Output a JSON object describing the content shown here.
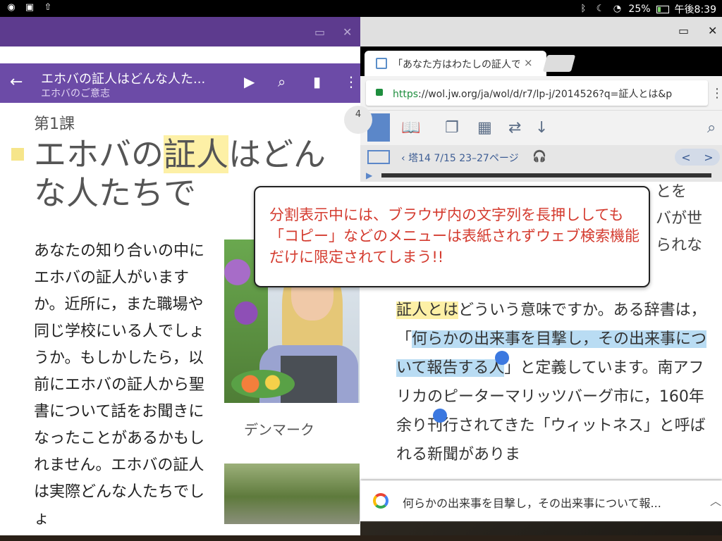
{
  "status_bar": {
    "left_icons": [
      "chrome-icon",
      "image-icon",
      "upload-icon"
    ],
    "battery": "25%",
    "time": "午後8:39"
  },
  "left_window": {
    "controls": {
      "restore": "▭",
      "close": "✕"
    },
    "app_bar": {
      "title": "エホバの証人はどんな人た...",
      "subtitle": "エホバのご意志"
    },
    "lesson_label": "第1課",
    "headline_pre": "エホバの",
    "headline_hl": "証人",
    "headline_post": "はどんな人たちで",
    "body": "あなたの知り合いの中にエホバの証人がいますか。近所に，また職場や同じ学校にいる人でしょうか。もしかしたら，以前にエホバの証人から聖書について話をお聞きになったことがあるかもしれません。エホバの証人は実際どんな人たちでしょ",
    "photo_caption": "デンマーク",
    "scroll_marker": "4"
  },
  "right_window": {
    "controls": {
      "restore": "▭",
      "close": "✕"
    },
    "tab": {
      "title": "「あなた方はわたしの証人で",
      "close": "×"
    },
    "url": {
      "scheme": "https",
      "rest": "://wol.jw.org/ja/wol/d/r7/lp-j/2014526?q=証人とは&p"
    },
    "nav": {
      "label": "塔14 7/15 23–27ページ",
      "prev": "<",
      "next": ">"
    },
    "peek_lines": [
      "とを",
      "バが世",
      "られな"
    ],
    "body": {
      "seg1_hl": "証人とは",
      "seg2": "どういう意味ですか。ある辞書は，「",
      "seg3_sel": "何らかの出来事を目撃し，その出来事について報告する人",
      "seg4": "」と定義しています。南アフリカのピーターマリッツバーグ市に，160年余り刊行されてきた「ウィットネス」と呼ばれる新聞がありま"
    }
  },
  "google_bar": {
    "query": "何らかの出来事を目撃し，その出来事について報..."
  },
  "callout": {
    "text": "分割表示中には、ブラウザ内の文字列を長押ししても「コピー」などのメニューは表紙されずウェブ検索機能だけに限定されてしまう!!"
  },
  "colors": {
    "left_header": "#5d3b8e",
    "left_appbar": "#6c4ba7",
    "highlight_yellow": "#fdf0a6",
    "selection_blue": "#b9dcf3",
    "callout_text": "#d43b2f",
    "jw_blue": "#5b87c9"
  }
}
